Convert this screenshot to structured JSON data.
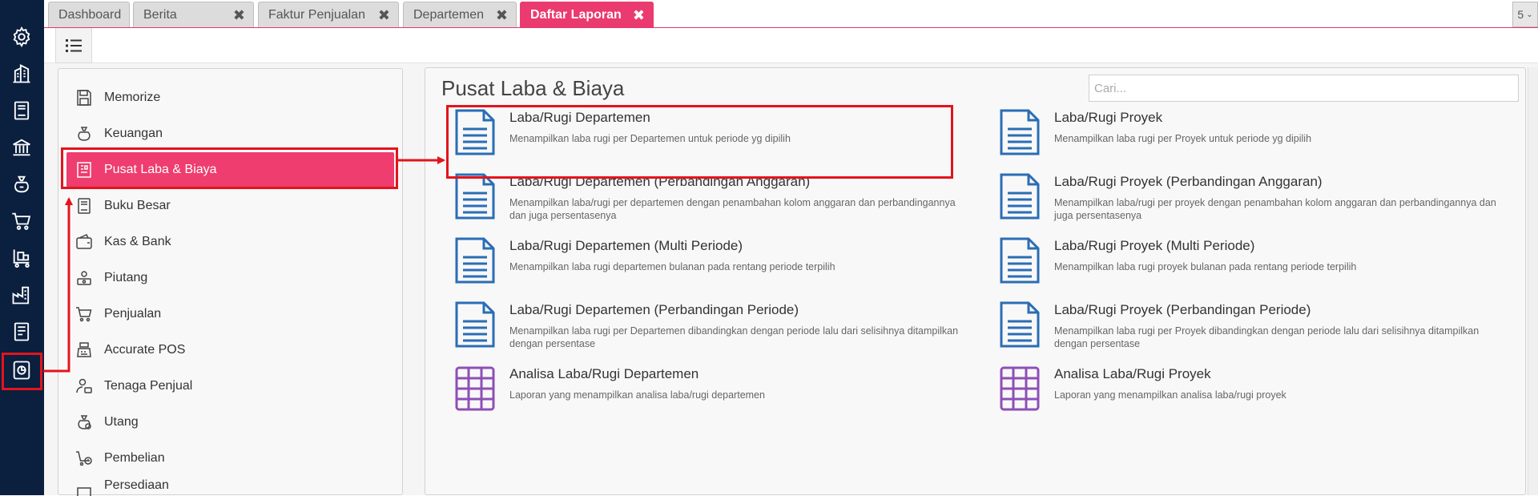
{
  "tabs": [
    {
      "label": "Dashboard",
      "closable": false
    },
    {
      "label": "Berita",
      "closable": true
    },
    {
      "label": "Faktur Penjualan",
      "closable": true
    },
    {
      "label": "Departemen",
      "closable": true
    },
    {
      "label": "Daftar Laporan",
      "closable": true,
      "active": true
    }
  ],
  "tab_count": "5",
  "menu": {
    "items": [
      {
        "label": "Memorize",
        "icon": "floppy-icon"
      },
      {
        "label": "Keuangan",
        "icon": "money-bag-icon"
      },
      {
        "label": "Pusat Laba & Biaya",
        "icon": "building-chart-icon",
        "active": true
      },
      {
        "label": "Buku Besar",
        "icon": "ledger-book-icon"
      },
      {
        "label": "Kas & Bank",
        "icon": "wallet-icon"
      },
      {
        "label": "Piutang",
        "icon": "hand-money-icon"
      },
      {
        "label": "Penjualan",
        "icon": "cart-icon"
      },
      {
        "label": "Accurate POS",
        "icon": "cash-register-icon"
      },
      {
        "label": "Tenaga Penjual",
        "icon": "salesperson-icon"
      },
      {
        "label": "Utang",
        "icon": "debt-icon"
      },
      {
        "label": "Pembelian",
        "icon": "purchase-icon"
      },
      {
        "label": "Persediaan",
        "icon": "inventory-icon"
      }
    ]
  },
  "reports_panel": {
    "title": "Pusat Laba & Biaya",
    "search_placeholder": "Cari...",
    "reports": [
      {
        "title": "Laba/Rugi Departemen",
        "desc": "Menampilkan laba rugi per Departemen untuk periode yg dipilih",
        "icon": "document-icon"
      },
      {
        "title": "Laba/Rugi Proyek",
        "desc": "Menampilkan laba rugi per Proyek untuk periode yg dipilih",
        "icon": "document-icon"
      },
      {
        "title": "Laba/Rugi Departemen (Perbandingan Anggaran)",
        "desc": "Menampilkan laba/rugi per departemen dengan penambahan kolom anggaran dan perbandingannya dan juga persentasenya",
        "icon": "document-icon"
      },
      {
        "title": "Laba/Rugi Proyek (Perbandingan Anggaran)",
        "desc": "Menampilkan laba/rugi per proyek dengan penambahan kolom anggaran dan perbandingannya dan juga persentasenya",
        "icon": "document-icon"
      },
      {
        "title": "Laba/Rugi Departemen (Multi Periode)",
        "desc": "Menampilkan laba rugi departemen bulanan pada rentang periode terpilih",
        "icon": "document-icon"
      },
      {
        "title": "Laba/Rugi Proyek (Multi Periode)",
        "desc": "Menampilkan laba rugi proyek bulanan pada rentang periode terpilih",
        "icon": "document-icon"
      },
      {
        "title": "Laba/Rugi Departemen (Perbandingan Periode)",
        "desc": "Menampilkan laba rugi per Departemen dibandingkan dengan periode lalu dari selisihnya ditampilkan dengan persentase",
        "icon": "document-icon"
      },
      {
        "title": "Laba/Rugi Proyek (Perbandingan Periode)",
        "desc": "Menampilkan laba rugi per Proyek dibandingkan dengan periode lalu dari selisihnya ditampilkan dengan persentase",
        "icon": "document-icon"
      },
      {
        "title": "Analisa Laba/Rugi Departemen",
        "desc": "Laporan yang menampilkan analisa laba/rugi departemen",
        "icon": "grid-table-icon"
      },
      {
        "title": "Analisa Laba/Rugi Proyek",
        "desc": "Laporan yang menampilkan analisa laba/rugi proyek",
        "icon": "grid-table-icon"
      }
    ]
  },
  "rail_icons": [
    "gear-icon",
    "building-icon",
    "book-icon",
    "bank-icon",
    "money-bag-icon",
    "cart-icon",
    "delivery-cart-icon",
    "factory-icon",
    "tax-document-icon",
    "report-chart-icon"
  ],
  "colors": {
    "rail_bg": "#0b1f3f",
    "accent": "#ea3a70",
    "highlight": "#e3141c",
    "doc_icon": "#2a6db5",
    "grid_icon": "#8e4fb5"
  }
}
